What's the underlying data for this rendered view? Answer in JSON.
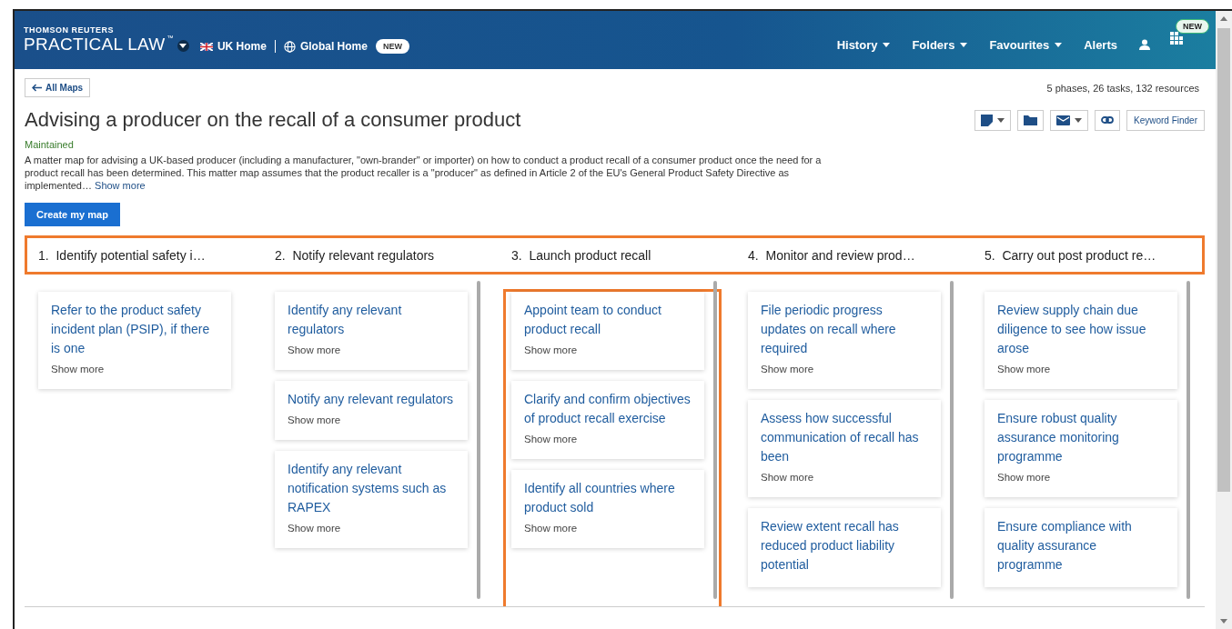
{
  "header": {
    "brand_top": "THOMSON REUTERS",
    "brand": "PRACTICAL LAW",
    "trademark": "™",
    "home_links": [
      {
        "label": "UK Home",
        "kind": "flag"
      },
      {
        "label": "Global Home",
        "kind": "globe"
      }
    ],
    "home_badge": "NEW",
    "nav": [
      {
        "label": "History",
        "dropdown": true
      },
      {
        "label": "Folders",
        "dropdown": true
      },
      {
        "label": "Favourites",
        "dropdown": true
      },
      {
        "label": "Alerts",
        "dropdown": false
      }
    ],
    "apps_badge": "NEW"
  },
  "back_button": "All Maps",
  "summary": "5 phases, 26 tasks, 132 resources",
  "title": "Advising a producer on the recall of a consumer product",
  "status": "Maintained",
  "description": "A matter map for advising a UK-based producer (including a manufacturer, \"own-brander\" or importer) on how to conduct a product recall of a consumer product once the need for a product recall has been determined. This matter map assumes that the product recaller is a \"producer\" as defined in Article 2 of the EU's General Product Safety Directive as implemented…",
  "description_link": "Show more",
  "tools": [
    {
      "kind": "note",
      "dropdown": true
    },
    {
      "kind": "folder",
      "dropdown": false
    },
    {
      "kind": "mail",
      "dropdown": true
    },
    {
      "kind": "link",
      "dropdown": false
    }
  ],
  "keyword_button": "Keyword Finder",
  "create_button": "Create my map",
  "phases": [
    {
      "number": "1.",
      "title": "Identify potential safety i…",
      "highlighted": false,
      "scrollbar": false,
      "tasks": [
        {
          "title": "Refer to the product safety incident plan (PSIP), if there is one",
          "link": "Show more"
        }
      ]
    },
    {
      "number": "2.",
      "title": "Notify relevant regulators",
      "highlighted": false,
      "scrollbar": true,
      "tasks": [
        {
          "title": "Identify any relevant regulators",
          "link": "Show more"
        },
        {
          "title": "Notify any relevant regulators",
          "link": "Show more"
        },
        {
          "title": "Identify any relevant notification systems such as RAPEX",
          "link": "Show more"
        }
      ]
    },
    {
      "number": "3.",
      "title": "Launch product recall",
      "highlighted": true,
      "scrollbar": true,
      "tasks": [
        {
          "title": "Appoint team to conduct product recall",
          "link": "Show more"
        },
        {
          "title": "Clarify and confirm objectives of product recall exercise",
          "link": "Show more"
        },
        {
          "title": "Identify all countries where product sold",
          "link": "Show more"
        }
      ]
    },
    {
      "number": "4.",
      "title": "Monitor and review prod…",
      "highlighted": false,
      "scrollbar": true,
      "tasks": [
        {
          "title": "File periodic progress updates on recall where required",
          "link": "Show more"
        },
        {
          "title": "Assess how successful communication of recall has been",
          "link": "Show more"
        },
        {
          "title": "Review extent recall has reduced product liability potential"
        }
      ]
    },
    {
      "number": "5.",
      "title": "Carry out post product re…",
      "highlighted": false,
      "scrollbar": true,
      "tasks": [
        {
          "title": "Review supply chain due diligence to see how issue arose",
          "link": "Show more"
        },
        {
          "title": "Ensure robust quality assurance monitoring programme",
          "link": "Show more"
        },
        {
          "title": "Ensure compliance with quality assurance programme"
        }
      ]
    }
  ],
  "phases_highlighted": true
}
